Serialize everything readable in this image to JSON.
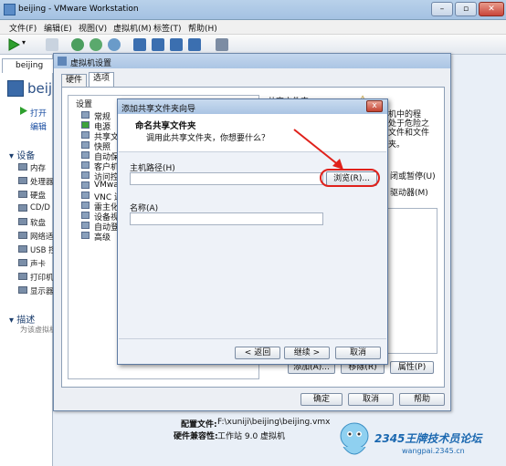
{
  "window": {
    "title": "beijing - VMware Workstation"
  },
  "menu": [
    "文件(F)",
    "编辑(E)",
    "视图(V)",
    "虚拟机(M)",
    "标签(T)",
    "帮助(H)"
  ],
  "vm_tab": "beijing",
  "left_panel": {
    "vm_name": "beij",
    "links": [
      "打开",
      "编辑"
    ],
    "devices_header": "设备",
    "devices": [
      "内存",
      "处理器",
      "硬盘",
      "CD/D",
      "软盘",
      "网络适",
      "USB 控",
      "声卡",
      "打印机",
      "显示器"
    ],
    "desc_header": "描述",
    "desc_placeholder": "为该虚拟机"
  },
  "vm_details": {
    "config_label": "配置文件:",
    "config_value": "F:\\xuniji\\beijing\\beijing.vmx",
    "compat_label": "硬件兼容性:",
    "compat_value": "工作站 9.0 虚拟机"
  },
  "settings": {
    "title": "虚拟机设置",
    "tabs": [
      "硬件",
      "选项"
    ],
    "tree_header": "设置",
    "tree_items": [
      "常规",
      "电源",
      "共享文件夹",
      "快照",
      "自动保护",
      "客户机隔离",
      "访问控制",
      "VMware To",
      "VNC 连接",
      "雷主化",
      "设备视图",
      "自动登录",
      "高级"
    ],
    "right_header": "共享文件夹",
    "right_text": [
      "机中的程",
      "处于危险之",
      "文件和文件夹。"
    ],
    "right_options": [
      "闭或暂停(U)",
      "驱动器(M)"
    ],
    "button_add": "添加(A)...",
    "button_remove": "移除(R)",
    "button_props": "属性(P)",
    "ok": "确定",
    "cancel": "取消",
    "help": "帮助"
  },
  "wizard": {
    "title": "添加共享文件夹向导",
    "close": "x",
    "heading": "命名共享文件夹",
    "subheading": "调用此共享文件夹，你想要什么？",
    "host_path_label": "主机路径(H)",
    "host_path_value": "",
    "browse": "浏览(R)...",
    "name_label": "名称(A)",
    "name_value": "",
    "back": "< 返回",
    "next": "继续 >",
    "cancel": "取消"
  },
  "watermark": {
    "text": "2345王牌技术员论坛",
    "url": "wangpai.2345.cn"
  },
  "colors": {
    "highlight": "#e0211b",
    "arrow": "#e0211b",
    "link": "#1a4ea2"
  }
}
